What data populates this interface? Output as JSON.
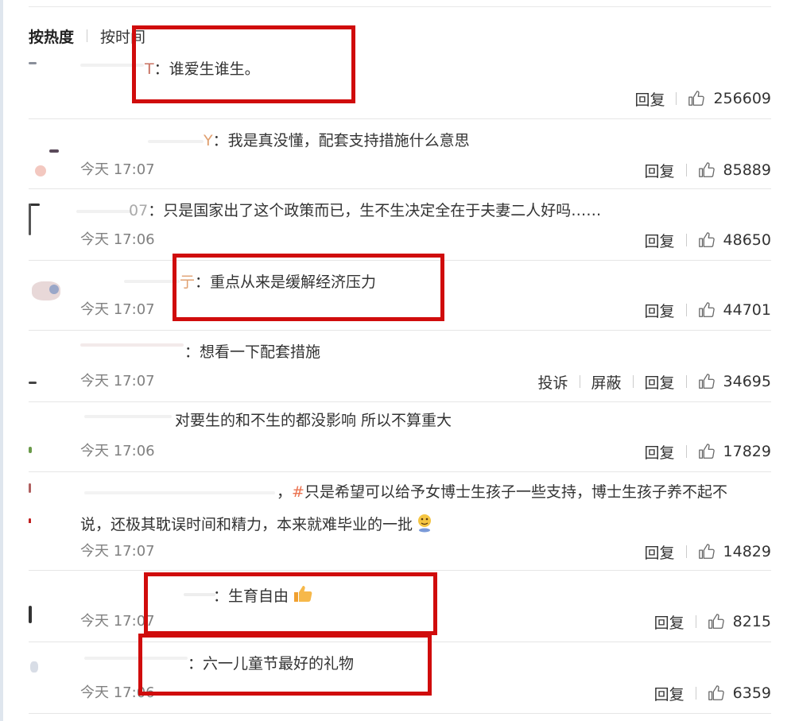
{
  "sort_tabs": [
    "按热度",
    "按时间"
  ],
  "actions": {
    "reply": "回复",
    "report": "投诉",
    "block": "屏蔽"
  },
  "colors": {
    "highlight_box": "#d00c0c",
    "topic_link": "#eb7350",
    "time_text": "#808080"
  },
  "comments": [
    {
      "user_suffix": "T",
      "text": "：谁爱生谁生。",
      "time": "",
      "likes": "256609"
    },
    {
      "user_suffix": "Y",
      "text": "：我是真没懂，配套支持措施什么意思",
      "time": "今天 17:07",
      "likes": "85889"
    },
    {
      "user_suffix": "07",
      "text": "：只是国家出了这个政策而已，生不生决定全在于夫妻二人好吗……",
      "time": "今天 17:06",
      "likes": "48650"
    },
    {
      "user_suffix": "亍",
      "text": "：重点从来是缓解经济压力",
      "time": "今天 17:07",
      "likes": "44701"
    },
    {
      "user_suffix": "",
      "text": "：想看一下配套措施",
      "time": "今天 17:07",
      "likes": "34695"
    },
    {
      "user_suffix": "",
      "text": "对要生的和不生的都没影响 所以不算重大",
      "time": "今天 17:06",
      "likes": "17829"
    },
    {
      "user_suffix": "",
      "text_prefix": "，",
      "topic": "#",
      "text": "只是希望可以给予女博士生孩子一些支持，博士生孩子养不起不",
      "text_line2": "说，还极其耽误时间和精力，本来就难毕业的一批",
      "time": "今天 17:07",
      "likes": "14829"
    },
    {
      "user_suffix": "",
      "text": "：生育自由",
      "time": "今天 17:07",
      "likes": "8215"
    },
    {
      "user_suffix": "",
      "text": "：六一儿童节最好的礼物",
      "time": "今天 17:06",
      "likes": "6359"
    }
  ]
}
